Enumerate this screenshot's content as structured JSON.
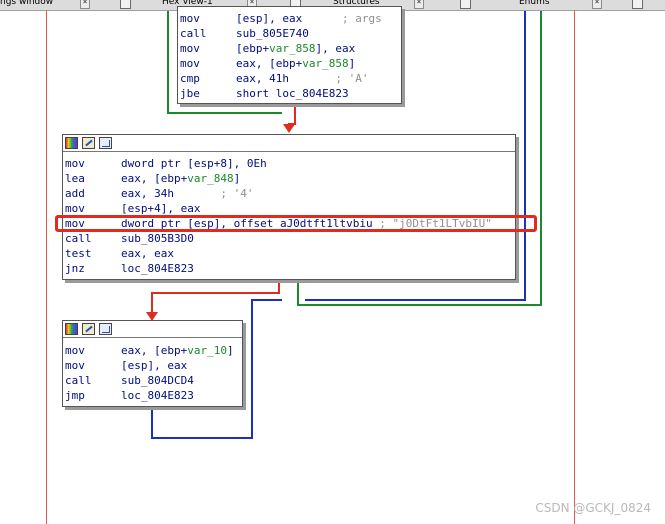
{
  "tabs": [
    {
      "label": "ngs window"
    },
    {
      "label": "Hex View-1"
    },
    {
      "label": "Structures"
    },
    {
      "label": "Enums"
    }
  ],
  "blocks": {
    "top": {
      "lines": [
        {
          "mnemonic": "mov",
          "operand": "[esp], eax",
          "var": "",
          "suffix": "",
          "comment": "; args"
        },
        {
          "mnemonic": "call",
          "operand": "sub_805E740",
          "var": "",
          "suffix": "",
          "comment": ""
        },
        {
          "mnemonic": "mov",
          "operand": "[ebp+",
          "var": "var_858",
          "suffix": "], eax",
          "comment": ""
        },
        {
          "mnemonic": "mov",
          "operand": "eax, [ebp+",
          "var": "var_858",
          "suffix": "]",
          "comment": ""
        },
        {
          "mnemonic": "cmp",
          "operand": "eax, 41h",
          "var": "",
          "suffix": "",
          "comment": "; 'A'"
        },
        {
          "mnemonic": "jbe",
          "operand": "short loc_804E823",
          "var": "",
          "suffix": "",
          "comment": ""
        }
      ]
    },
    "middle": {
      "lines": [
        {
          "mnemonic": "mov",
          "operand": "dword ptr [esp+8], 0Eh",
          "var": "",
          "suffix": "",
          "comment": ""
        },
        {
          "mnemonic": "lea",
          "operand": "eax, [ebp+",
          "var": "var_848",
          "suffix": "]",
          "comment": ""
        },
        {
          "mnemonic": "add",
          "operand": "eax, 34h",
          "var": "",
          "suffix": "",
          "comment": "; '4'"
        },
        {
          "mnemonic": "mov",
          "operand": "[esp+4], eax",
          "var": "",
          "suffix": "",
          "comment": ""
        },
        {
          "mnemonic": "mov",
          "operand": "dword ptr [esp], offset aJ0dtft1ltvbiu",
          "var": "",
          "suffix": "",
          "comment": "; \"j0DtFt1LTvbIU\""
        },
        {
          "mnemonic": "call",
          "operand": "sub_805B3D0",
          "var": "",
          "suffix": "",
          "comment": ""
        },
        {
          "mnemonic": "test",
          "operand": "eax, eax",
          "var": "",
          "suffix": "",
          "comment": ""
        },
        {
          "mnemonic": "jnz",
          "operand": "loc_804E823",
          "var": "",
          "suffix": "",
          "comment": ""
        }
      ]
    },
    "bottom": {
      "lines": [
        {
          "mnemonic": "mov",
          "operand": "eax, [ebp+",
          "var": "var_10",
          "suffix": "]",
          "comment": ""
        },
        {
          "mnemonic": "mov",
          "operand": "[esp], eax",
          "var": "",
          "suffix": "",
          "comment": ""
        },
        {
          "mnemonic": "call",
          "operand": "sub_804DCD4",
          "var": "",
          "suffix": "",
          "comment": ""
        },
        {
          "mnemonic": "jmp",
          "operand": "loc_804E823",
          "var": "",
          "suffix": "",
          "comment": ""
        }
      ]
    }
  },
  "colors": {
    "instruction": "#000d7f",
    "variable": "#1a8a2a",
    "comment": "#8f8f8f",
    "edge_true": "#1a8a2a",
    "edge_false": "#e02b1f",
    "edge_flow": "#1c2fbf",
    "highlight": "#e02b1f"
  },
  "watermark": "CSDN @GCKJ_0824"
}
